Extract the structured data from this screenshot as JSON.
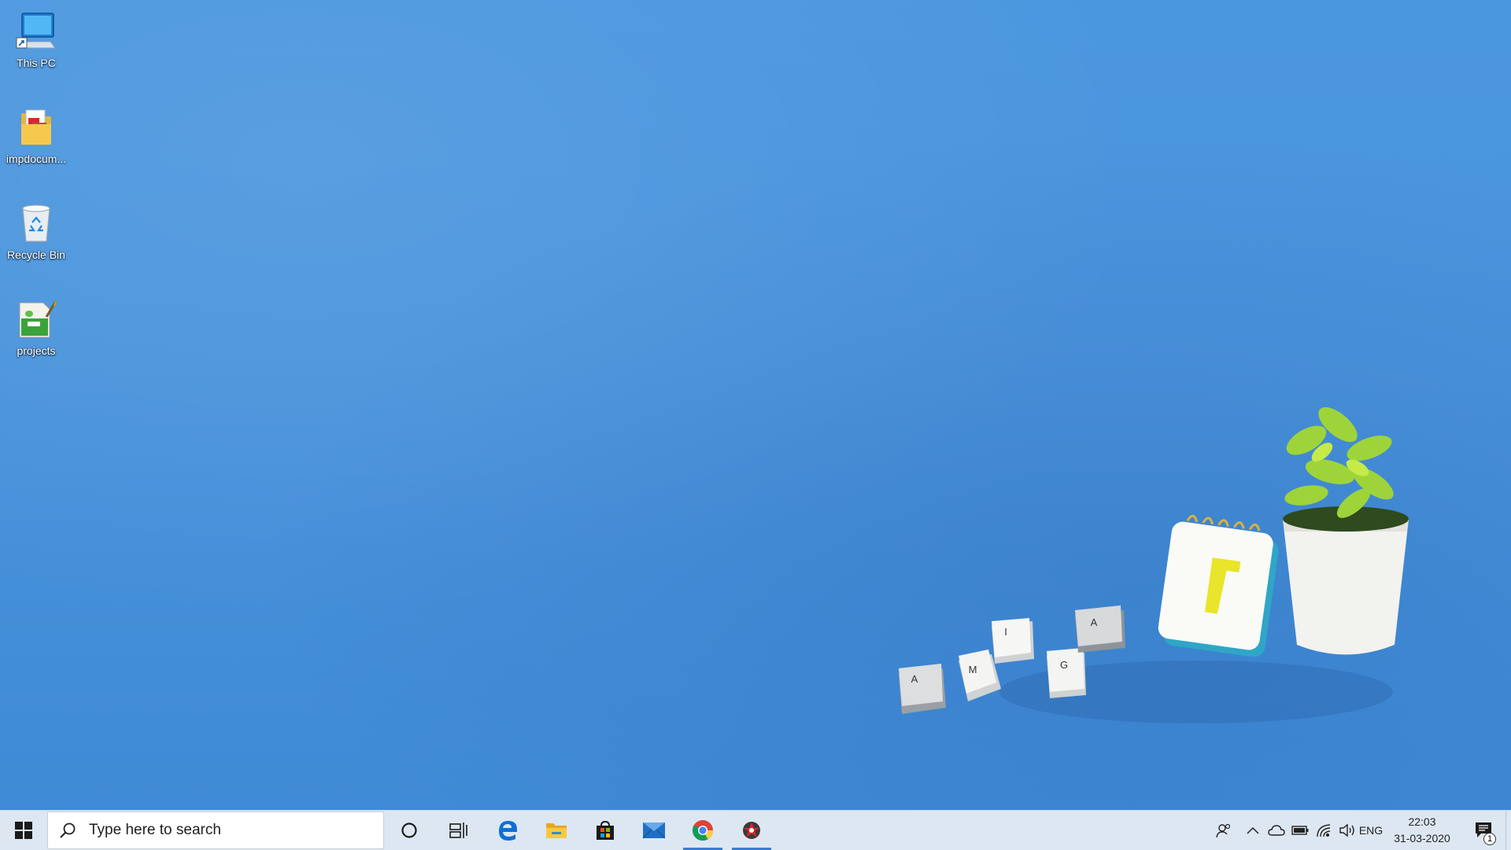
{
  "desktop": {
    "icons": [
      {
        "label": "This PC",
        "icon": "this-pc-icon"
      },
      {
        "label": "impdocum...",
        "icon": "folder-icon"
      },
      {
        "label": "Recycle Bin",
        "icon": "recycle-bin-icon"
      },
      {
        "label": "projects",
        "icon": "projects-file-icon"
      }
    ],
    "wallpaper": {
      "keycaps": [
        "A",
        "M",
        "I",
        "G",
        "A"
      ]
    }
  },
  "taskbar": {
    "search_placeholder": "Type here to search",
    "apps": [
      {
        "name": "Cortana",
        "icon": "cortana-icon"
      },
      {
        "name": "Task View",
        "icon": "task-view-icon"
      },
      {
        "name": "Microsoft Edge",
        "icon": "edge-icon"
      },
      {
        "name": "File Explorer",
        "icon": "file-explorer-icon"
      },
      {
        "name": "Microsoft Store",
        "icon": "store-icon"
      },
      {
        "name": "Mail",
        "icon": "mail-icon"
      },
      {
        "name": "Google Chrome",
        "icon": "chrome-icon",
        "active": true
      },
      {
        "name": "App",
        "icon": "red-app-icon",
        "active": true
      }
    ],
    "tray": {
      "language": "ENG",
      "time": "22:03",
      "date": "31-03-2020",
      "notification_count": "1"
    },
    "accent": "#3a7ed1",
    "background": "#dde7f2"
  }
}
